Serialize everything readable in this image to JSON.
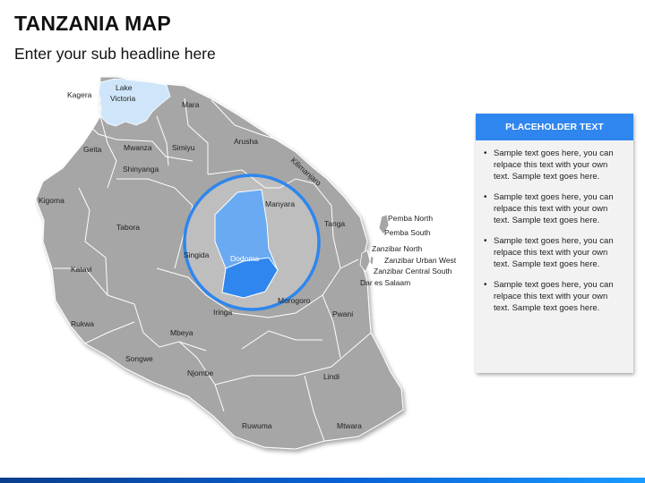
{
  "header": {
    "title": "TANZANIA MAP",
    "subtitle": "Enter your sub headline here"
  },
  "map": {
    "highlight_region": "Dodoma",
    "colors": {
      "region_fill": "#a6a6a6",
      "region_stroke": "#ffffff",
      "lake_fill": "#cfe6fa",
      "highlight_fill": "#2f86ee",
      "zoom_ring": "#2f86ee"
    },
    "labels": {
      "kagera": "Kagera",
      "lake_victoria_1": "Lake",
      "lake_victoria_2": "Victoria",
      "mara": "Mara",
      "geita": "Geita",
      "mwanza": "Mwanza",
      "simiyu": "Simiyu",
      "arusha": "Arusha",
      "shinyanga": "Shinyanga",
      "kilimanjaro": "Kilimanjaro",
      "kigoma": "Kigoma",
      "manyara": "Manyara",
      "tanga": "Tanga",
      "tabora": "Tabora",
      "singida": "Singida",
      "dodoma": "Dodoma",
      "pemba_north": "Pemba North",
      "pemba_south": "Pemba South",
      "zanzibar_north": "Zanzibar North",
      "zanzibar_urban_west": "Zanzibar Urban West",
      "zanzibar_central_south": "Zanzibar Central South",
      "dar_es_salaam": "Dar es Salaam",
      "katavi": "Katavi",
      "morogoro": "Morogoro",
      "iringa": "Iringa",
      "pwani": "Pwani",
      "rukwa": "Rukwa",
      "mbeya": "Mbeya",
      "songwe": "Songwe",
      "njombe": "Njombe",
      "lindi": "Lindi",
      "ruvuma": "Ruwuma",
      "mtwara": "Mtwara"
    }
  },
  "panel": {
    "header": "PLACEHOLDER TEXT",
    "items": [
      "Sample text goes here, you can relpace this text with your own text. Sample text goes here.",
      "Sample text goes here, you can relpace this text with your own text. Sample text goes here.",
      "Sample text goes here, you can relpace this text with your own text. Sample text goes here.",
      "Sample text goes here, you can relpace this text with your own text. Sample text goes here."
    ]
  }
}
